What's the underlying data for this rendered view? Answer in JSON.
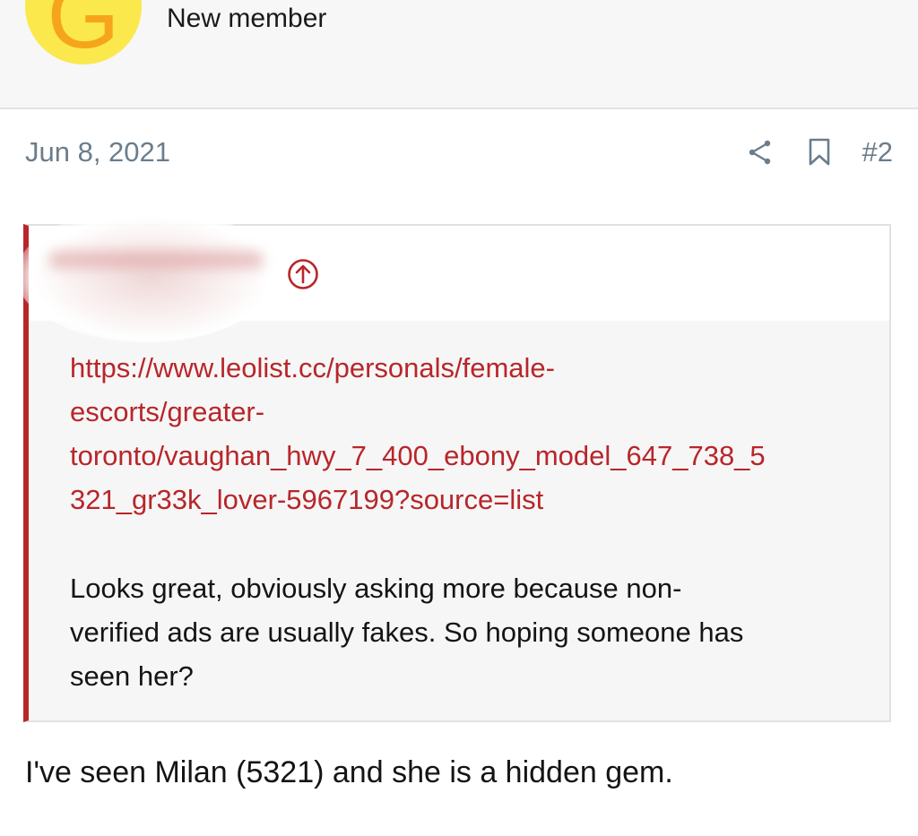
{
  "author": {
    "avatar_letter": "G",
    "title": "New member"
  },
  "post": {
    "date": "Jun 8, 2021",
    "number": "#2",
    "icons": {
      "share": "share-icon",
      "bookmark": "bookmark-icon",
      "goto": "arrow-up-circle-icon"
    }
  },
  "quote": {
    "link_lines": [
      "https://www.leolist.cc/personals/female-",
      "escorts/greater-",
      "toronto/vaughan_hwy_7_400_ebony_model_647_738_5",
      "321_gr33k_lover-5967199?source=list"
    ],
    "text_lines": [
      "Looks great, obviously asking more because non-",
      "verified ads are usually fakes. So hoping someone has",
      "seen her?"
    ]
  },
  "reply": {
    "text": "I've seen Milan (5321) and she is a hidden gem."
  },
  "colors": {
    "accent": "#b8262a",
    "muted": "#6b7d8c",
    "avatar_bg": "#fbe84d",
    "avatar_letter": "#f6a51a"
  }
}
